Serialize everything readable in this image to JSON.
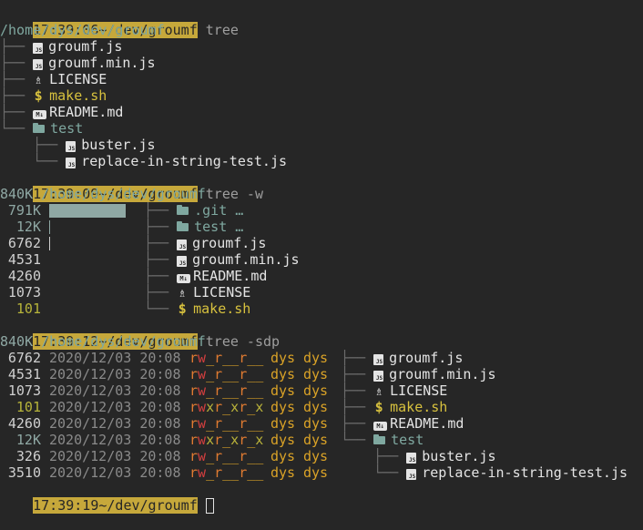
{
  "prompt": {
    "path": "~/dev/groumf",
    "times": [
      "17:39:06",
      "17:39:09",
      "17:39:12",
      "17:39:19"
    ],
    "commands": [
      "tree",
      "tree -w",
      "tree -sdp",
      ""
    ],
    "accent_color": "#c6a83b"
  },
  "tree1": {
    "root": "/home/dys/dev/groumf",
    "entries": [
      {
        "prefix": "├──",
        "icon": "js-file-icon",
        "name": "groumf.js"
      },
      {
        "prefix": "├──",
        "icon": "js-file-icon",
        "name": "groumf.min.js"
      },
      {
        "prefix": "├──",
        "icon": "license-icon",
        "name": "LICENSE"
      },
      {
        "prefix": "├──",
        "icon": "dollar-icon",
        "name": "make.sh"
      },
      {
        "prefix": "├──",
        "icon": "markdown-icon",
        "name": "README.md"
      },
      {
        "prefix": "└──",
        "icon": "folder-icon",
        "name": "test"
      },
      {
        "prefix": "    ├──",
        "icon": "js-file-icon",
        "name": "buster.js"
      },
      {
        "prefix": "    └──",
        "icon": "js-file-icon",
        "name": "replace-in-string-test.js"
      }
    ]
  },
  "tree2": {
    "root_size": "840K",
    "root": "/home/dys/dev/groumf",
    "entries": [
      {
        "size": "791K",
        "prefix": "├──",
        "icon": "folder-icon",
        "name": ".git …",
        "bar_fraction": 1.0
      },
      {
        "size": "12K",
        "prefix": "├──",
        "icon": "folder-icon",
        "name": "test …",
        "bar_fraction": 0.015
      },
      {
        "size": "6762",
        "prefix": "├──",
        "icon": "js-file-icon",
        "name": "groumf.js",
        "bar_fraction": 0.0
      },
      {
        "size": "4531",
        "prefix": "├──",
        "icon": "js-file-icon",
        "name": "groumf.min.js",
        "bar_fraction": 0.0
      },
      {
        "size": "4260",
        "prefix": "├──",
        "icon": "markdown-icon",
        "name": "README.md",
        "bar_fraction": 0.0
      },
      {
        "size": "1073",
        "prefix": "├──",
        "icon": "license-icon",
        "name": "LICENSE",
        "bar_fraction": 0.0
      },
      {
        "size": "101",
        "prefix": "└──",
        "icon": "dollar-icon",
        "name": "make.sh",
        "bar_fraction": 0.0
      }
    ]
  },
  "tree3": {
    "root_size": "840K",
    "root": "/home/dys/dev/groumf",
    "entries": [
      {
        "size": "6762",
        "date": "2020/12/03 20:08",
        "perm": "rw_r__r__",
        "user": "dys",
        "group": "dys",
        "prefix": "├──",
        "icon": "js-file-icon",
        "name": "groumf.js"
      },
      {
        "size": "4531",
        "date": "2020/12/03 20:08",
        "perm": "rw_r__r__",
        "user": "dys",
        "group": "dys",
        "prefix": "├──",
        "icon": "js-file-icon",
        "name": "groumf.min.js"
      },
      {
        "size": "1073",
        "date": "2020/12/03 20:08",
        "perm": "rw_r__r__",
        "user": "dys",
        "group": "dys",
        "prefix": "├──",
        "icon": "license-icon",
        "name": "LICENSE"
      },
      {
        "size": "101",
        "date": "2020/12/03 20:08",
        "perm": "rwxr_xr_x",
        "user": "dys",
        "group": "dys",
        "prefix": "├──",
        "icon": "dollar-icon",
        "name": "make.sh"
      },
      {
        "size": "4260",
        "date": "2020/12/03 20:08",
        "perm": "rw_r__r__",
        "user": "dys",
        "group": "dys",
        "prefix": "├──",
        "icon": "markdown-icon",
        "name": "README.md"
      },
      {
        "size": "12K",
        "date": "2020/12/03 20:08",
        "perm": "rwxr_xr_x",
        "user": "dys",
        "group": "dys",
        "prefix": "└──",
        "icon": "folder-icon",
        "name": "test"
      },
      {
        "size": "326",
        "date": "2020/12/03 20:08",
        "perm": "rw_r__r__",
        "user": "dys",
        "group": "dys",
        "prefix": "    ├──",
        "icon": "js-file-icon",
        "name": "buster.js"
      },
      {
        "size": "3510",
        "date": "2020/12/03 20:08",
        "perm": "rw_r__r__",
        "user": "dys",
        "group": "dys",
        "prefix": "    └──",
        "icon": "js-file-icon",
        "name": "replace-in-string-test.js"
      }
    ]
  }
}
